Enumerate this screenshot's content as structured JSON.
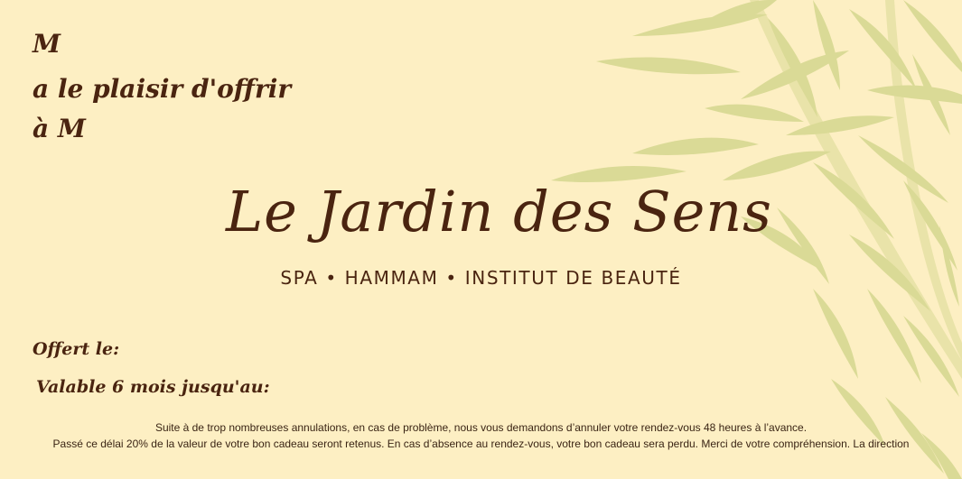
{
  "gift": {
    "from_line": "M",
    "offer_line": "a le plaisir d'offrir",
    "to_line": "à M"
  },
  "brand": {
    "title": "Le Jardin des Sens",
    "subtitle": "SPA • HAMMAM • INSTITUT DE BEAUTÉ"
  },
  "fields": {
    "offered_label": "Offert le:",
    "valid_label": "Valable 6 mois jusqu'au:"
  },
  "notice": {
    "line1": "Suite à de trop nombreuses annulations, en cas de problème, nous vous demandons d’annuler votre rendez-vous 48 heures à l’avance.",
    "line2": "Passé ce délai 20% de la valeur de votre bon cadeau seront retenus. En cas d’absence au rendez-vous, votre bon cadeau sera perdu. Merci de votre compréhension. La direction"
  },
  "colors": {
    "background": "#fdefc3",
    "text": "#4a2410",
    "leaves": "#d4d68f"
  }
}
